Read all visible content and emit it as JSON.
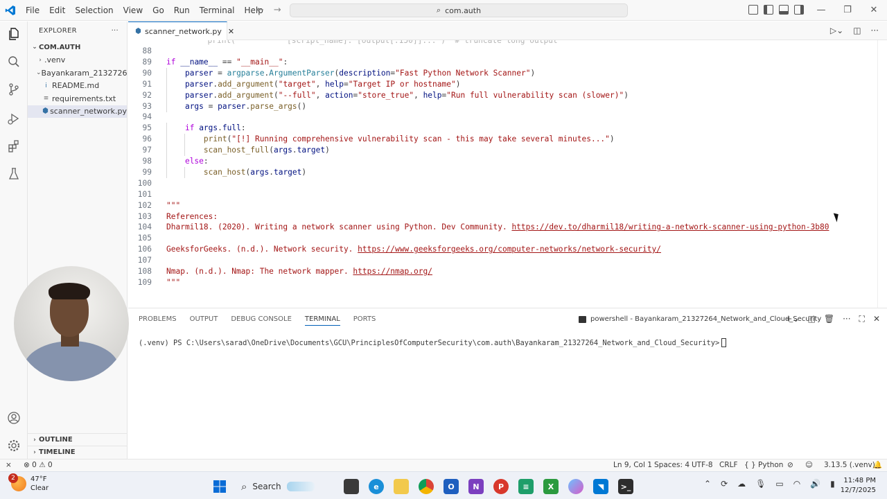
{
  "menu": [
    "File",
    "Edit",
    "Selection",
    "View",
    "Go",
    "Run",
    "Terminal",
    "Help"
  ],
  "search": {
    "text": "com.auth"
  },
  "explorer": {
    "title": "EXPLORER",
    "root": "COM.AUTH",
    "items": [
      {
        "label": ".venv",
        "type": "folder",
        "expanded": false
      },
      {
        "label": "Bayankaram_2132726...",
        "type": "folder",
        "expanded": true
      },
      {
        "label": "README.md",
        "type": "markdown",
        "icon": "i"
      },
      {
        "label": "requirements.txt",
        "type": "text",
        "icon": "≡"
      },
      {
        "label": "scanner_network.py",
        "type": "python",
        "selected": true
      }
    ],
    "outline": "OUTLINE",
    "timeline": "TIMELINE"
  },
  "editor": {
    "tab": "scanner_network.py",
    "lines": [
      {
        "n": "88",
        "t": ""
      },
      {
        "n": "89",
        "t": "if __name__ == \"__main__\":"
      },
      {
        "n": "90",
        "t": "    parser = argparse.ArgumentParser(description=\"Fast Python Network Scanner\")"
      },
      {
        "n": "91",
        "t": "    parser.add_argument(\"target\", help=\"Target IP or hostname\")"
      },
      {
        "n": "92",
        "t": "    parser.add_argument(\"--full\", action=\"store_true\", help=\"Run full vulnerability scan (slower)\")"
      },
      {
        "n": "93",
        "t": "    args = parser.parse_args()"
      },
      {
        "n": "94",
        "t": ""
      },
      {
        "n": "95",
        "t": "    if args.full:"
      },
      {
        "n": "96",
        "t": "        print(\"[!] Running comprehensive vulnerability scan - this may take several minutes...\")"
      },
      {
        "n": "97",
        "t": "        scan_host_full(args.target)"
      },
      {
        "n": "98",
        "t": "    else:"
      },
      {
        "n": "99",
        "t": "        scan_host(args.target)"
      },
      {
        "n": "100",
        "t": ""
      },
      {
        "n": "101",
        "t": ""
      },
      {
        "n": "102",
        "t": "\"\"\""
      },
      {
        "n": "103",
        "t": "References:"
      },
      {
        "n": "104",
        "t": "Dharmil18. (2020). Writing a network scanner using Python. Dev Community. https://dev.to/dharmil18/writing-a-network-scanner-using-python-3b80"
      },
      {
        "n": "105",
        "t": ""
      },
      {
        "n": "106",
        "t": "GeeksforGeeks. (n.d.). Network security. https://www.geeksforgeeks.org/computer-networks/network-security/"
      },
      {
        "n": "107",
        "t": ""
      },
      {
        "n": "108",
        "t": "Nmap. (n.d.). Nmap: The network mapper. https://nmap.org/"
      },
      {
        "n": "109",
        "t": "\"\"\""
      }
    ]
  },
  "panel": {
    "tabs": [
      "PROBLEMS",
      "OUTPUT",
      "DEBUG CONSOLE",
      "TERMINAL",
      "PORTS"
    ],
    "active_tab": "TERMINAL",
    "terminal_name": "powershell - Bayankaram_21327264_Network_and_Cloud_Security",
    "prompt": "(.venv) PS C:\\Users\\sarad\\OneDrive\\Documents\\GCU\\PrinciplesOfComputerSecurity\\com.auth\\Bayankaram_21327264_Network_and_Cloud_Security>"
  },
  "status": {
    "errors": "0",
    "warnings": "0",
    "position": "Ln 9, Col 1",
    "spaces": "Spaces: 4",
    "encoding": "UTF-8",
    "eol": "CRLF",
    "language": "Python",
    "interpreter": "3.13.5 (.venv)"
  },
  "taskbar": {
    "weather_temp": "47°F",
    "weather_desc": "Clear",
    "weather_badge": "2",
    "search": "Search",
    "time": "11:48 PM",
    "date": "12/7/2025"
  },
  "colors": {
    "accent": "#005fb8",
    "python_icon": "#3572a5",
    "keyword": "#af00db",
    "string": "#a31515"
  }
}
